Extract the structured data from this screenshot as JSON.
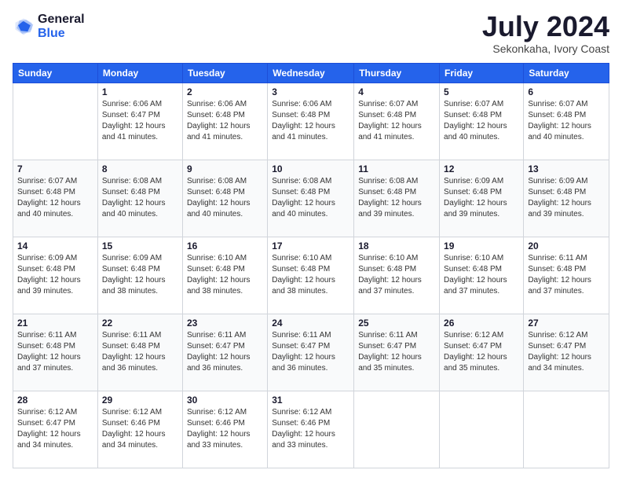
{
  "logo": {
    "general": "General",
    "blue": "Blue"
  },
  "title": {
    "month_year": "July 2024",
    "location": "Sekonkaha, Ivory Coast"
  },
  "weekdays": [
    "Sunday",
    "Monday",
    "Tuesday",
    "Wednesday",
    "Thursday",
    "Friday",
    "Saturday"
  ],
  "weeks": [
    [
      {
        "day": "",
        "info": ""
      },
      {
        "day": "1",
        "info": "Sunrise: 6:06 AM\nSunset: 6:47 PM\nDaylight: 12 hours\nand 41 minutes."
      },
      {
        "day": "2",
        "info": "Sunrise: 6:06 AM\nSunset: 6:48 PM\nDaylight: 12 hours\nand 41 minutes."
      },
      {
        "day": "3",
        "info": "Sunrise: 6:06 AM\nSunset: 6:48 PM\nDaylight: 12 hours\nand 41 minutes."
      },
      {
        "day": "4",
        "info": "Sunrise: 6:07 AM\nSunset: 6:48 PM\nDaylight: 12 hours\nand 41 minutes."
      },
      {
        "day": "5",
        "info": "Sunrise: 6:07 AM\nSunset: 6:48 PM\nDaylight: 12 hours\nand 40 minutes."
      },
      {
        "day": "6",
        "info": "Sunrise: 6:07 AM\nSunset: 6:48 PM\nDaylight: 12 hours\nand 40 minutes."
      }
    ],
    [
      {
        "day": "7",
        "info": "Sunrise: 6:07 AM\nSunset: 6:48 PM\nDaylight: 12 hours\nand 40 minutes."
      },
      {
        "day": "8",
        "info": "Sunrise: 6:08 AM\nSunset: 6:48 PM\nDaylight: 12 hours\nand 40 minutes."
      },
      {
        "day": "9",
        "info": "Sunrise: 6:08 AM\nSunset: 6:48 PM\nDaylight: 12 hours\nand 40 minutes."
      },
      {
        "day": "10",
        "info": "Sunrise: 6:08 AM\nSunset: 6:48 PM\nDaylight: 12 hours\nand 40 minutes."
      },
      {
        "day": "11",
        "info": "Sunrise: 6:08 AM\nSunset: 6:48 PM\nDaylight: 12 hours\nand 39 minutes."
      },
      {
        "day": "12",
        "info": "Sunrise: 6:09 AM\nSunset: 6:48 PM\nDaylight: 12 hours\nand 39 minutes."
      },
      {
        "day": "13",
        "info": "Sunrise: 6:09 AM\nSunset: 6:48 PM\nDaylight: 12 hours\nand 39 minutes."
      }
    ],
    [
      {
        "day": "14",
        "info": "Sunrise: 6:09 AM\nSunset: 6:48 PM\nDaylight: 12 hours\nand 39 minutes."
      },
      {
        "day": "15",
        "info": "Sunrise: 6:09 AM\nSunset: 6:48 PM\nDaylight: 12 hours\nand 38 minutes."
      },
      {
        "day": "16",
        "info": "Sunrise: 6:10 AM\nSunset: 6:48 PM\nDaylight: 12 hours\nand 38 minutes."
      },
      {
        "day": "17",
        "info": "Sunrise: 6:10 AM\nSunset: 6:48 PM\nDaylight: 12 hours\nand 38 minutes."
      },
      {
        "day": "18",
        "info": "Sunrise: 6:10 AM\nSunset: 6:48 PM\nDaylight: 12 hours\nand 37 minutes."
      },
      {
        "day": "19",
        "info": "Sunrise: 6:10 AM\nSunset: 6:48 PM\nDaylight: 12 hours\nand 37 minutes."
      },
      {
        "day": "20",
        "info": "Sunrise: 6:11 AM\nSunset: 6:48 PM\nDaylight: 12 hours\nand 37 minutes."
      }
    ],
    [
      {
        "day": "21",
        "info": "Sunrise: 6:11 AM\nSunset: 6:48 PM\nDaylight: 12 hours\nand 37 minutes."
      },
      {
        "day": "22",
        "info": "Sunrise: 6:11 AM\nSunset: 6:48 PM\nDaylight: 12 hours\nand 36 minutes."
      },
      {
        "day": "23",
        "info": "Sunrise: 6:11 AM\nSunset: 6:47 PM\nDaylight: 12 hours\nand 36 minutes."
      },
      {
        "day": "24",
        "info": "Sunrise: 6:11 AM\nSunset: 6:47 PM\nDaylight: 12 hours\nand 36 minutes."
      },
      {
        "day": "25",
        "info": "Sunrise: 6:11 AM\nSunset: 6:47 PM\nDaylight: 12 hours\nand 35 minutes."
      },
      {
        "day": "26",
        "info": "Sunrise: 6:12 AM\nSunset: 6:47 PM\nDaylight: 12 hours\nand 35 minutes."
      },
      {
        "day": "27",
        "info": "Sunrise: 6:12 AM\nSunset: 6:47 PM\nDaylight: 12 hours\nand 34 minutes."
      }
    ],
    [
      {
        "day": "28",
        "info": "Sunrise: 6:12 AM\nSunset: 6:47 PM\nDaylight: 12 hours\nand 34 minutes."
      },
      {
        "day": "29",
        "info": "Sunrise: 6:12 AM\nSunset: 6:46 PM\nDaylight: 12 hours\nand 34 minutes."
      },
      {
        "day": "30",
        "info": "Sunrise: 6:12 AM\nSunset: 6:46 PM\nDaylight: 12 hours\nand 33 minutes."
      },
      {
        "day": "31",
        "info": "Sunrise: 6:12 AM\nSunset: 6:46 PM\nDaylight: 12 hours\nand 33 minutes."
      },
      {
        "day": "",
        "info": ""
      },
      {
        "day": "",
        "info": ""
      },
      {
        "day": "",
        "info": ""
      }
    ]
  ]
}
